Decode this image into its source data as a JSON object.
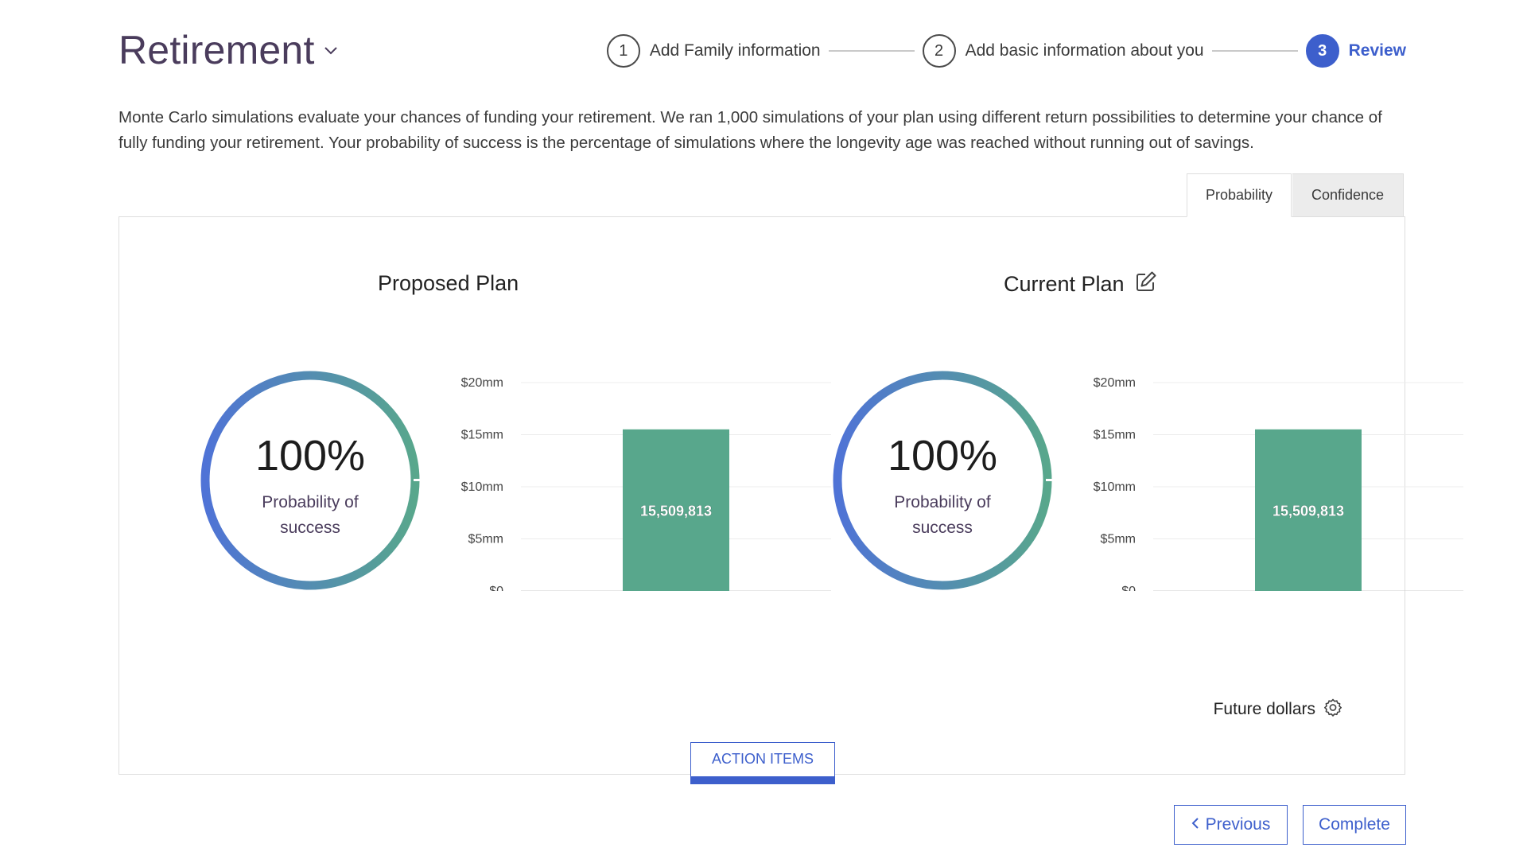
{
  "header": {
    "title": "Retirement"
  },
  "stepper": {
    "steps": [
      {
        "number": "1",
        "label": "Add Family information"
      },
      {
        "number": "2",
        "label": "Add basic information about you"
      },
      {
        "number": "3",
        "label": "Review"
      }
    ],
    "active_color": "#3d5fcc"
  },
  "description": "Monte Carlo simulations evaluate your chances of funding your retirement. We ran 1,000 simulations of your plan using different return possibilities to determine your chance of fully funding your retirement. Your probability of success is the percentage of simulations where the longevity age was reached without running out of savings.",
  "tabs": [
    {
      "label": "Probability",
      "active": true
    },
    {
      "label": "Confidence",
      "active": false
    }
  ],
  "plans": [
    {
      "title": "Proposed Plan",
      "probability": "100%",
      "probability_fraction": 1.0,
      "probability_label": "Probability of success"
    },
    {
      "title": "Current Plan",
      "probability": "100%",
      "probability_fraction": 1.0,
      "probability_label": "Probability of success"
    }
  ],
  "chart_data": [
    {
      "type": "bar",
      "title": "Proposed Plan",
      "categories": [
        ""
      ],
      "values": [
        15509813
      ],
      "data_labels": [
        "15,509,813"
      ],
      "yticks": [
        0,
        5000000,
        10000000,
        15000000,
        20000000
      ],
      "ytick_labels": [
        "$0",
        "$5mm",
        "$10mm",
        "$15mm",
        "$20mm"
      ],
      "ylim": [
        0,
        20000000
      ],
      "grid": true,
      "bar_color": "#58a78c"
    },
    {
      "type": "bar",
      "title": "Current Plan",
      "categories": [
        ""
      ],
      "values": [
        15509813
      ],
      "data_labels": [
        "15,509,813"
      ],
      "yticks": [
        0,
        5000000,
        10000000,
        15000000,
        20000000
      ],
      "ytick_labels": [
        "$0",
        "$5mm",
        "$10mm",
        "$15mm",
        "$20mm"
      ],
      "ylim": [
        0,
        20000000
      ],
      "grid": true,
      "bar_color": "#58a78c"
    }
  ],
  "future_dollars_label": "Future dollars",
  "action_items_label": "ACTION ITEMS",
  "footer": {
    "previous_label": "Previous",
    "complete_label": "Complete"
  },
  "icons": {
    "title": "chevron-down-icon",
    "edit": "edit-icon",
    "settings": "gear-icon",
    "previous": "chevron-left-icon"
  },
  "colors": {
    "accent": "#3d5fcc",
    "gauge_start": "#4f73d6",
    "gauge_end": "#58a78c",
    "bar": "#58a78c",
    "title": "#4a3c5c"
  }
}
